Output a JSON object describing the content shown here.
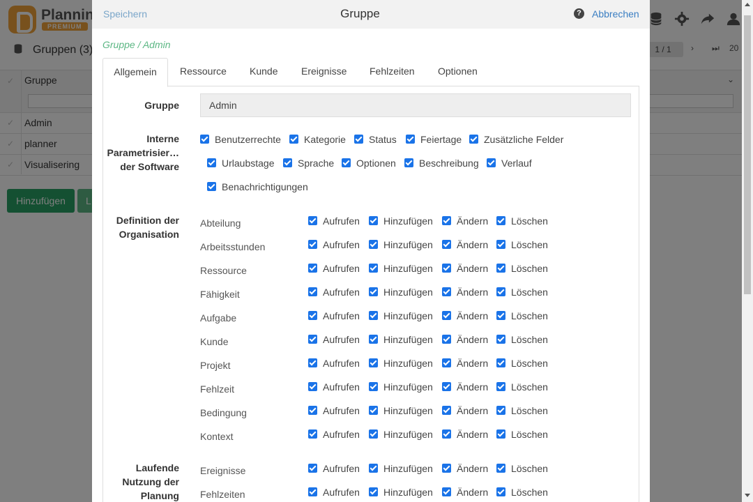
{
  "app": {
    "logo_text": "Planning",
    "logo_badge": "PREMIUM",
    "list_title": "Gruppen (3)",
    "pager_text": "1 / 1",
    "page_size": "20",
    "grid_column": "Gruppe",
    "rows": [
      "Admin",
      "planner",
      "Visualisering"
    ],
    "add_button": "Hinzufügen",
    "second_button": "L"
  },
  "modal": {
    "save": "Speichern",
    "title": "Gruppe",
    "help": "?",
    "cancel": "Abbrechen",
    "breadcrumb": "Gruppe / Admin",
    "tabs": [
      "Allgemein",
      "Ressource",
      "Kunde",
      "Ereignisse",
      "Fehlzeiten",
      "Optionen"
    ],
    "active_tab": "Allgemein",
    "gruppe_label": "Gruppe",
    "gruppe_value": "Admin",
    "interne_label_1": "Interne",
    "interne_label_2": "Parametrisier…",
    "interne_label_3": "der Software",
    "interne_options": [
      "Benutzerrechte",
      "Kategorie",
      "Status",
      "Feiertage",
      "Zusätzliche Felder",
      "Urlaubstage",
      "Sprache",
      "Optionen",
      "Beschreibung",
      "Verlauf",
      "Benachrichtigungen"
    ],
    "definition_label_1": "Definition der",
    "definition_label_2": "Organisation",
    "actions": [
      "Aufrufen",
      "Hinzufügen",
      "Ändern",
      "Löschen"
    ],
    "definition_rows": [
      "Abteilung",
      "Arbeitsstunden",
      "Ressource",
      "Fähigkeit",
      "Aufgabe",
      "Kunde",
      "Projekt",
      "Fehlzeit",
      "Bedingung",
      "Kontext"
    ],
    "laufende_label_1": "Laufende",
    "laufende_label_2": "Nutzung der",
    "laufende_label_3": "Planung",
    "laufende_rows": [
      "Ereignisse",
      "Fehlzeiten"
    ]
  },
  "colors": {
    "checkbox": "#1a73e8",
    "primary_green": "#28a065",
    "link_blue": "#3a7ec2",
    "breadcrumb_green": "#5cb784"
  }
}
